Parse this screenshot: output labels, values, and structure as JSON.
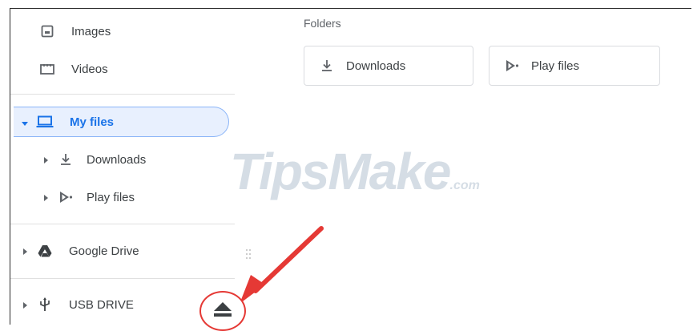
{
  "sidebar": {
    "items": [
      {
        "label": "Images",
        "icon": "image-icon"
      },
      {
        "label": "Videos",
        "icon": "video-icon"
      },
      {
        "label": "My files",
        "icon": "laptop-icon"
      },
      {
        "label": "Downloads",
        "icon": "download-icon"
      },
      {
        "label": "Play files",
        "icon": "play-store-icon"
      },
      {
        "label": "Google Drive",
        "icon": "google-drive-icon"
      },
      {
        "label": "USB DRIVE",
        "icon": "usb-icon"
      }
    ]
  },
  "main": {
    "section_title": "Folders",
    "folders": [
      {
        "label": "Downloads",
        "icon": "download-icon"
      },
      {
        "label": "Play files",
        "icon": "play-store-icon"
      }
    ]
  },
  "watermark": {
    "text": "TipsMake",
    "suffix": ".com"
  },
  "colors": {
    "accent": "#1a73e8",
    "annotation": "#e53935"
  }
}
